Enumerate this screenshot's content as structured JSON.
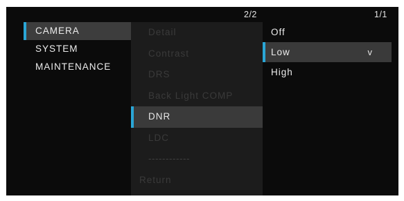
{
  "main_menu": {
    "items": [
      {
        "label": "CAMERA",
        "selected": true
      },
      {
        "label": "SYSTEM",
        "selected": false
      },
      {
        "label": "MAINTENANCE",
        "selected": false
      }
    ]
  },
  "sub_menu": {
    "page_indicator": "2/2",
    "items": [
      {
        "label": "Detail",
        "enabled": false
      },
      {
        "label": "Contrast",
        "enabled": false
      },
      {
        "label": "DRS",
        "enabled": false
      },
      {
        "label": "Back Light COMP",
        "enabled": false
      },
      {
        "label": "DNR",
        "enabled": true,
        "selected": true
      },
      {
        "label": "LDC",
        "enabled": false
      },
      {
        "label": "------------",
        "enabled": false
      },
      {
        "label": "Return",
        "enabled": false
      }
    ]
  },
  "options": {
    "page_indicator": "1/1",
    "items": [
      {
        "label": "Off",
        "selected": false
      },
      {
        "label": "Low",
        "selected": true,
        "marker": "v"
      },
      {
        "label": "High",
        "selected": false
      }
    ]
  },
  "colors": {
    "highlight_accent": "#2aa6d6",
    "background": "#0b0b0b"
  }
}
